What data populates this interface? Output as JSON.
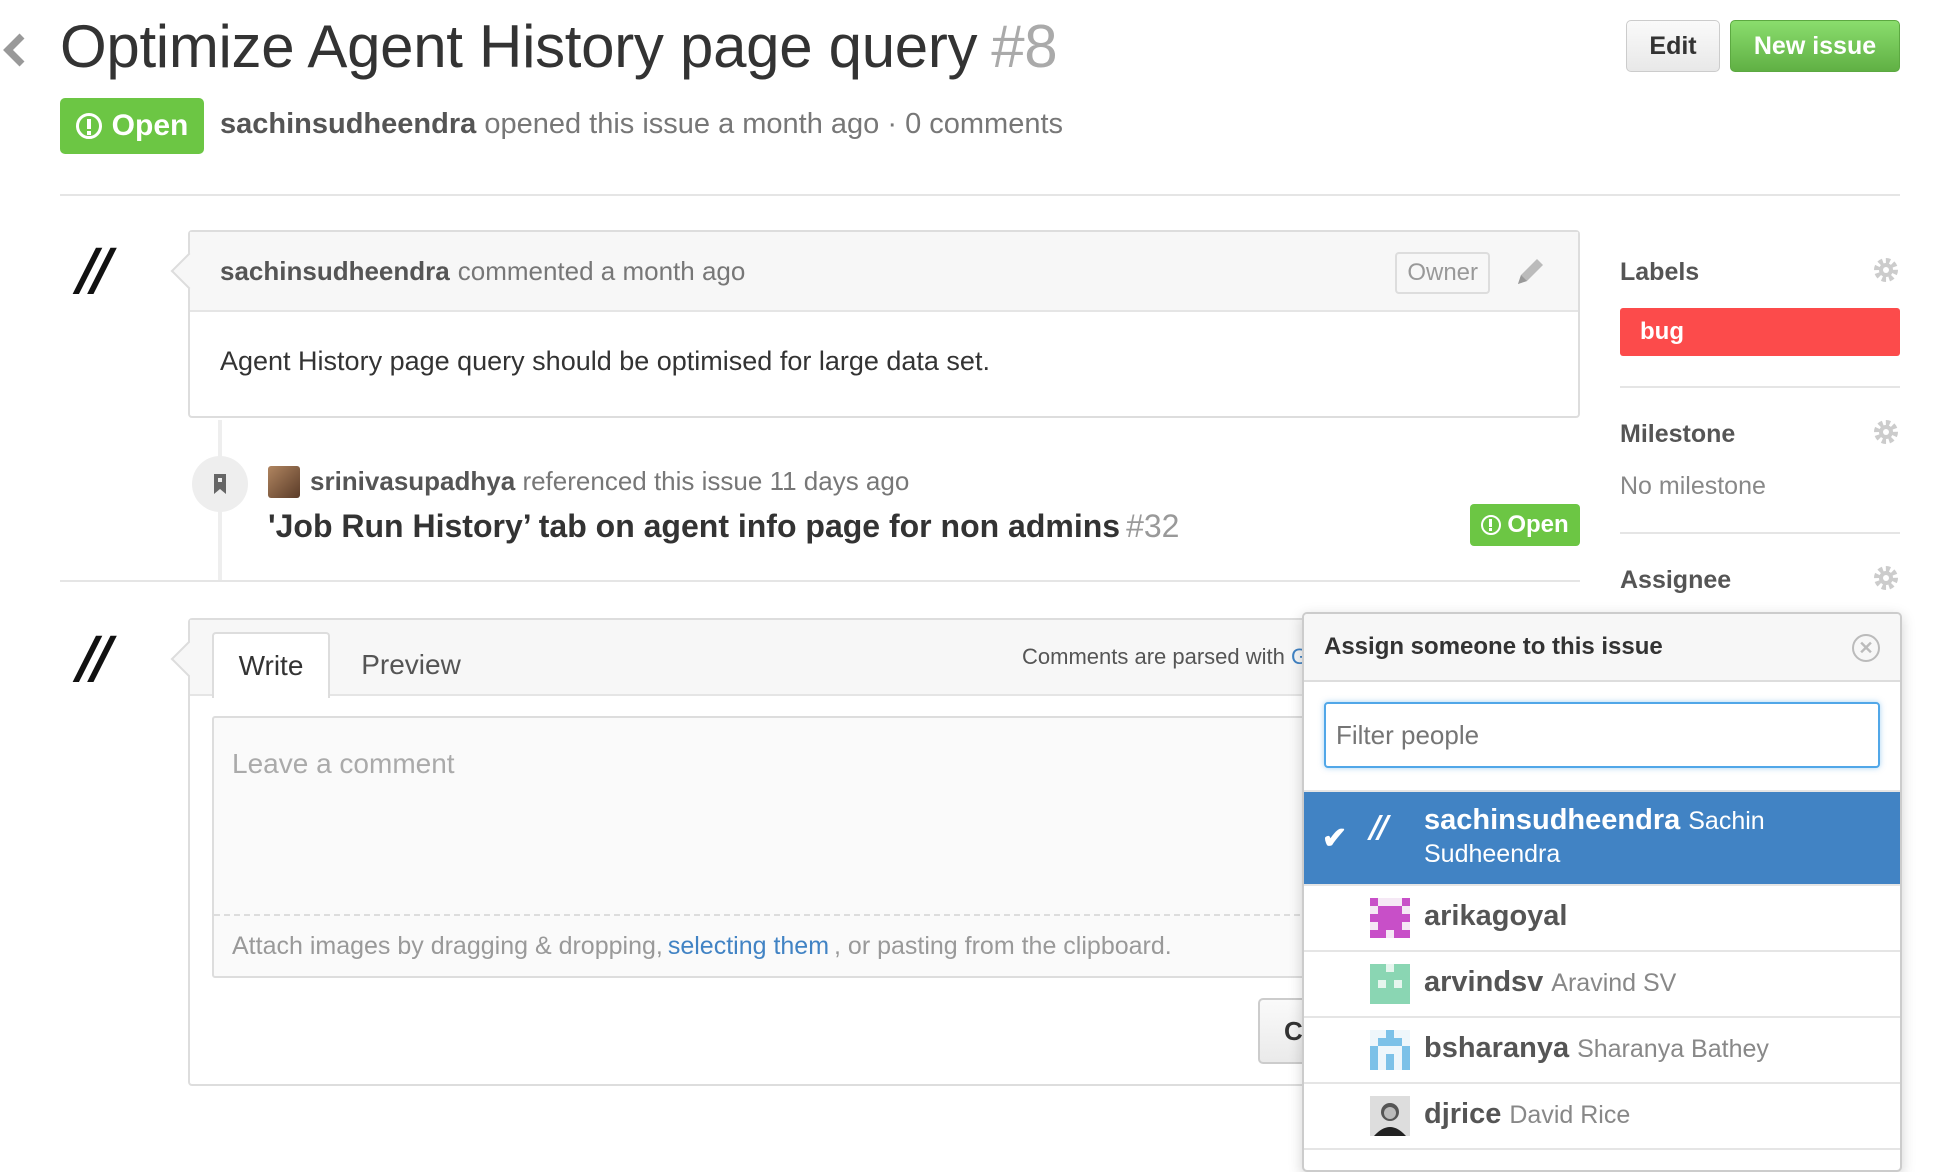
{
  "issue": {
    "title": "Optimize Agent History page query",
    "number": "#8",
    "state": "Open",
    "author": "sachinsudheendra",
    "opened_text": "opened this issue a month ago · 0 comments"
  },
  "toolbar": {
    "edit_label": "Edit",
    "new_issue_label": "New issue"
  },
  "avatar_mark": "//",
  "comment": {
    "author": "sachinsudheendra",
    "meta": "commented a month ago",
    "badge": "Owner",
    "body": "Agent History page query should be optimised for large data set."
  },
  "reference": {
    "user": "srinivasupadhya",
    "meta": "referenced this issue 11 days ago",
    "title": "'Job Run History’ tab on agent info page for non admins",
    "number": "#32",
    "state": "Open"
  },
  "form": {
    "tab_write": "Write",
    "tab_preview": "Preview",
    "parsed_text": "Comments are parsed with",
    "parsed_link": "G",
    "placeholder": "Leave a comment",
    "attach_prefix": "Attach images by dragging & dropping,",
    "attach_link": "selecting them",
    "attach_suffix": ", or pasting from the clipboard.",
    "submit_label": "Cl"
  },
  "sidebar": {
    "labels_title": "Labels",
    "label": "bug",
    "milestone_title": "Milestone",
    "milestone_value": "No milestone",
    "assignee_title": "Assignee"
  },
  "popup": {
    "title": "Assign someone to this issue",
    "filter_placeholder": "Filter people",
    "people": [
      {
        "username": "sachinsudheendra",
        "fullname": "Sachin",
        "fullname2": "Sudheendra",
        "selected": true
      },
      {
        "username": "arikagoyal",
        "fullname": ""
      },
      {
        "username": "arvindsv",
        "fullname": "Aravind SV"
      },
      {
        "username": "bsharanya",
        "fullname": "Sharanya Bathey"
      },
      {
        "username": "djrice",
        "fullname": "David Rice"
      }
    ]
  },
  "colors": {
    "open_green": "#6cc644",
    "bug_red": "#fc4b4b",
    "link_blue": "#4183c4",
    "selected_blue": "#4183c4"
  }
}
